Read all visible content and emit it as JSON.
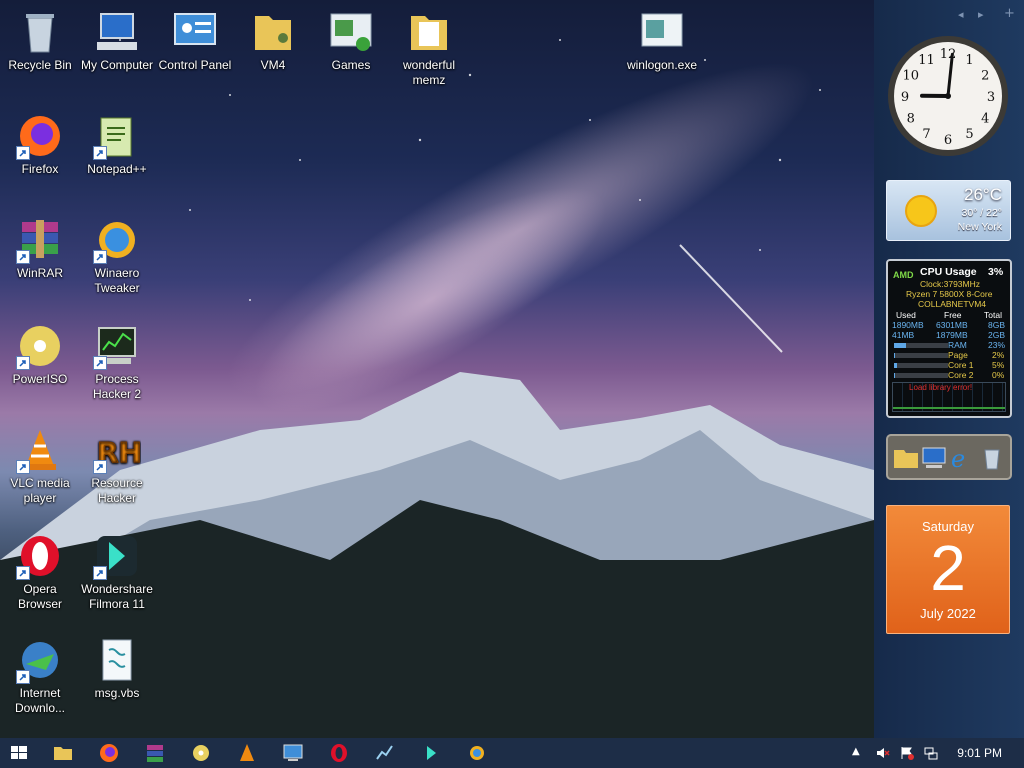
{
  "desktop_icons": {
    "recycle_bin": "Recycle Bin",
    "my_computer": "My Computer",
    "control_panel": "Control Panel",
    "vm4": "VM4",
    "games": "Games",
    "wonderful_memz": "wonderful memz",
    "winlogon": "winlogon.exe",
    "firefox": "Firefox",
    "notepadpp": "Notepad++",
    "winrar": "WinRAR",
    "winaero": "Winaero Tweaker",
    "poweriso": "PowerISO",
    "process_hacker": "Process Hacker 2",
    "vlc": "VLC media player",
    "resource_hacker": "Resource Hacker",
    "opera": "Opera Browser",
    "filmora": "Wondershare Filmora 11",
    "idm": "Internet Downlo...",
    "msgvbs": "msg.vbs"
  },
  "clock": {
    "numerals": [
      "12",
      "1",
      "2",
      "3",
      "4",
      "5",
      "6",
      "7",
      "8",
      "9",
      "10",
      "11"
    ],
    "hour": 9,
    "minute": 1
  },
  "weather": {
    "temp": "26°C",
    "hilo": "30° / 22°",
    "city": "New York"
  },
  "cpu": {
    "vendor": "AMD",
    "title": "CPU Usage",
    "pct": "3%",
    "clock": "Clock:3793MHz",
    "model": "Ryzen 7 5800X 8-Core",
    "host": "COLLABNETVM4",
    "headers": {
      "used": "Used",
      "free": "Free",
      "total": "Total"
    },
    "row1": {
      "used": "1890MB",
      "free": "6301MB",
      "total": "8GB"
    },
    "row2": {
      "used": "41MB",
      "free": "1879MB",
      "total": "2GB"
    },
    "meters": [
      {
        "label": "RAM",
        "value": "23%",
        "fill": 0.23
      },
      {
        "label": "Page",
        "value": "2%",
        "fill": 0.02
      },
      {
        "label": "Core 1",
        "value": "5%",
        "fill": 0.05
      },
      {
        "label": "Core 2",
        "value": "0%",
        "fill": 0.0
      }
    ],
    "error": "Load library error!"
  },
  "calendar": {
    "day": "Saturday",
    "date": "2",
    "month": "July 2022"
  },
  "taskbar": {
    "time": "9:01 PM"
  },
  "colors": {
    "taskbar": "#1d2d47",
    "calendar": "#e86e22",
    "accent": "#5fa8e8"
  }
}
